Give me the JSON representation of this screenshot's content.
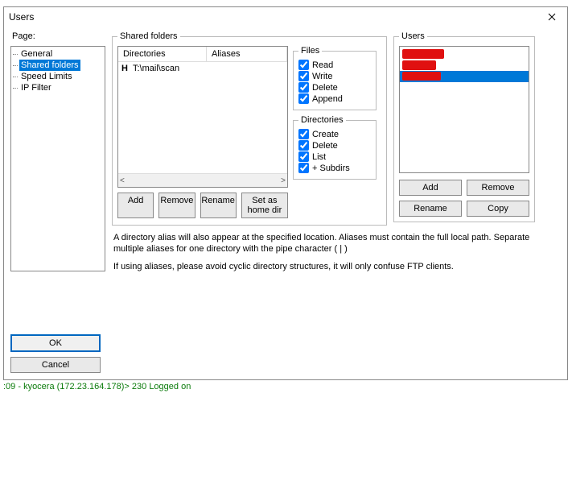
{
  "window": {
    "title": "Users"
  },
  "page": {
    "label": "Page:",
    "items": [
      "General",
      "Shared folders",
      "Speed Limits",
      "IP Filter"
    ],
    "selected_index": 1
  },
  "shared": {
    "legend": "Shared folders",
    "col_dir": "Directories",
    "col_alias": "Aliases",
    "row_prefix": "H",
    "row_path": "T:\\mail\\scan",
    "btn_add": "Add",
    "btn_remove": "Remove",
    "btn_rename": "Rename",
    "btn_sethome": "Set as home dir"
  },
  "perm": {
    "files_legend": "Files",
    "read": "Read",
    "write": "Write",
    "delete": "Delete",
    "append": "Append",
    "dirs_legend": "Directories",
    "create": "Create",
    "ddelete": "Delete",
    "list": "List",
    "subdirs": "+ Subdirs"
  },
  "help": {
    "line1": "A directory alias will also appear at the specified location. Aliases must contain the full local path. Separate multiple aliases for one directory with the pipe character ( | )",
    "line2": "If using aliases, please avoid cyclic directory structures, it will only confuse FTP clients."
  },
  "users": {
    "legend": "Users",
    "btn_add": "Add",
    "btn_remove": "Remove",
    "btn_rename": "Rename",
    "btn_copy": "Copy"
  },
  "footer": {
    "ok": "OK",
    "cancel": "Cancel"
  },
  "status": ":09 - kyocera (172.23.164.178)> 230 Logged on"
}
